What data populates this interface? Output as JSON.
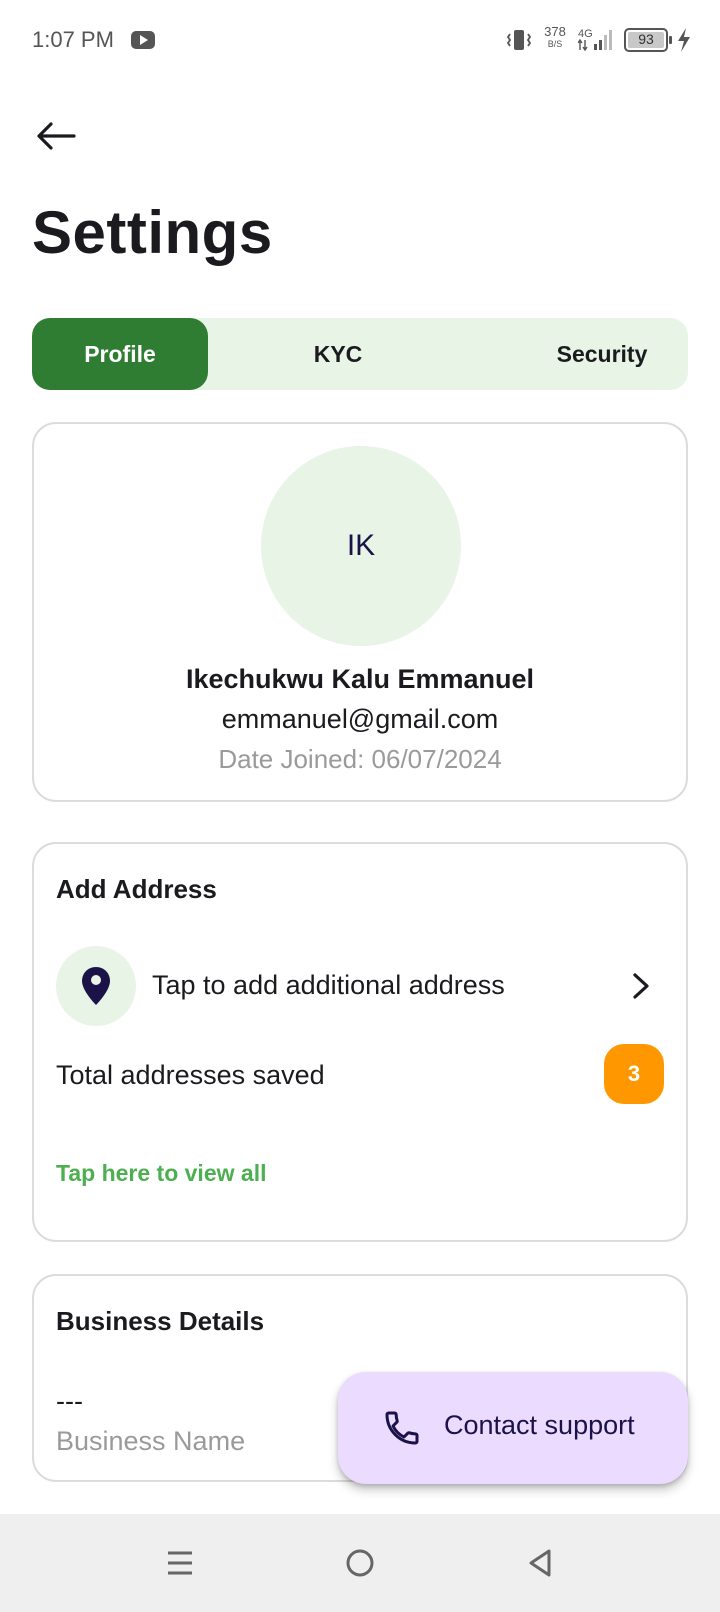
{
  "status_bar": {
    "time": "1:07 PM",
    "net_speed_value": "378",
    "net_speed_unit": "B/S",
    "network_type": "4G",
    "battery_level": "93"
  },
  "header": {
    "back_icon": "arrow-left-icon",
    "title": "Settings"
  },
  "tabs": [
    {
      "label": "Profile",
      "active": true
    },
    {
      "label": "KYC",
      "active": false
    },
    {
      "label": "Security",
      "active": false
    }
  ],
  "profile": {
    "initials": "IK",
    "name": "Ikechukwu Kalu Emmanuel",
    "email": "emmanuel@gmail.com",
    "date_joined": "Date Joined: 06/07/2024"
  },
  "address": {
    "title": "Add Address",
    "add_label": "Tap to add additional address",
    "total_label": "Total addresses saved",
    "total_count": "3",
    "view_all": "Tap here to view all"
  },
  "business": {
    "title": "Business Details",
    "name_value": "---",
    "name_label": "Business Name"
  },
  "support": {
    "label": "Contact support",
    "icon": "phone-icon"
  },
  "colors": {
    "primary_green": "#2e7d32",
    "tab_bg": "#e7f4e6",
    "link_green": "#4caf50",
    "badge_orange": "#ff9800",
    "fab_bg": "#eadbff",
    "navy": "#1b1348"
  }
}
